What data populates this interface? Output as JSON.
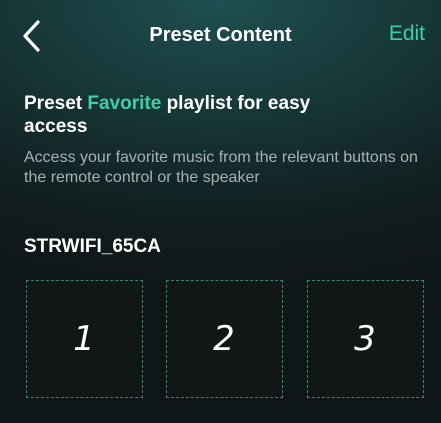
{
  "header": {
    "back_icon": "chevron-left-icon",
    "title": "Preset Content",
    "edit_label": "Edit"
  },
  "intro": {
    "headline_pre": "Preset ",
    "headline_accent": "Favorite",
    "headline_post": " playlist for easy access",
    "description": "Access your favorite music from the relevant buttons on the remote control or the speaker"
  },
  "device": {
    "name": "STRWIFI_65CA"
  },
  "presets": [
    {
      "label": "1"
    },
    {
      "label": "2"
    },
    {
      "label": "3"
    }
  ],
  "colors": {
    "accent": "#3ecfa9",
    "text": "#ffffff",
    "muted_text": "#a8b2b3",
    "slot_border": "#2f8a72"
  }
}
